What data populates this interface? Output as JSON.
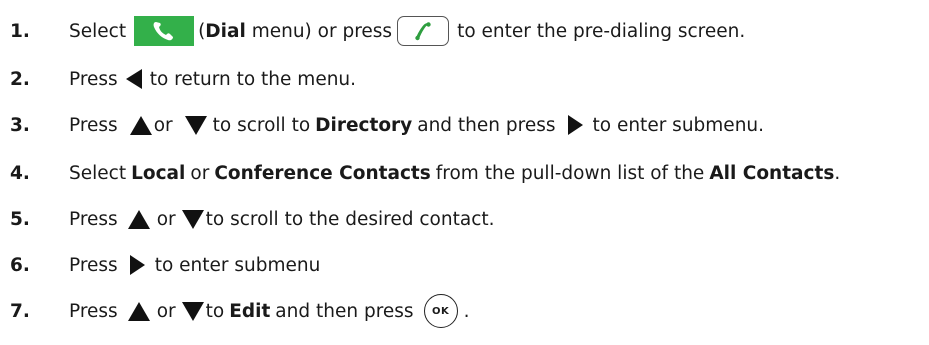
{
  "steps": [
    {
      "number": "1.",
      "parts": {
        "a": "Select",
        "b": "(",
        "c": "Dial",
        "d": " menu) or press",
        "e": "to enter the pre-dialing screen."
      }
    },
    {
      "number": "2.",
      "parts": {
        "a": "Press",
        "b": "to return to the menu."
      }
    },
    {
      "number": "3.",
      "parts": {
        "a": "Press",
        "b": "or",
        "c": "to scroll to",
        "d": "Directory",
        "e": "and then press",
        "f": "to enter submenu."
      }
    },
    {
      "number": "4.",
      "parts": {
        "a": "Select",
        "b": "Local",
        "c": "or",
        "d": "Conference Contacts",
        "e": "from the pull-down list of the",
        "f": "All Contacts",
        "g": "."
      }
    },
    {
      "number": "5.",
      "parts": {
        "a": "Press",
        "b": "or",
        "c": "to scroll to the desired contact."
      }
    },
    {
      "number": "6.",
      "parts": {
        "a": "Press",
        "b": "to enter submenu"
      }
    },
    {
      "number": "7.",
      "parts": {
        "a": "Press",
        "b": "or",
        "c": "to",
        "d": "Edit",
        "e": "and then press",
        "f": "."
      }
    }
  ],
  "icons": {
    "dial": "dial-menu-icon",
    "offhook": "off-hook-key-icon",
    "left": "left-arrow-icon",
    "right": "right-arrow-icon",
    "up": "up-arrow-icon",
    "down": "down-arrow-icon",
    "ok": "ok-key-icon",
    "ok_label": "OK"
  },
  "colors": {
    "dial_green": "#33b04a",
    "handset_green": "#2e9e3f",
    "text": "#1a1a1a"
  }
}
